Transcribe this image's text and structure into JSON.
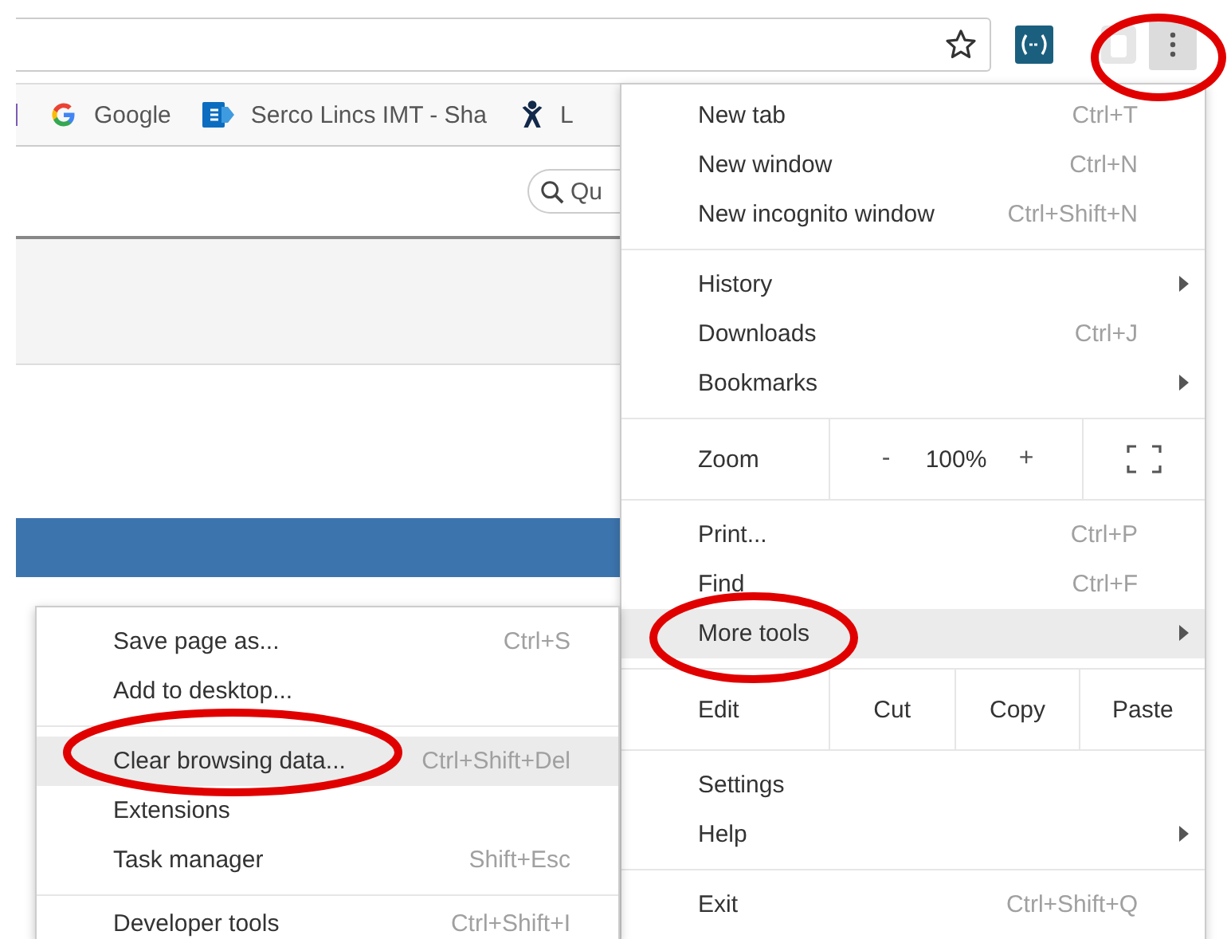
{
  "toolbar": {
    "bookmarked": false
  },
  "bookmarks": [
    {
      "kind": "partial"
    },
    {
      "kind": "google",
      "label": "Google"
    },
    {
      "kind": "sharepoint",
      "label": "Serco Lincs IMT - Sha"
    },
    {
      "kind": "figure",
      "label": "L"
    }
  ],
  "page": {
    "search": {
      "placeholder": "Qu"
    }
  },
  "menu": {
    "sections": [
      {
        "kind": "items",
        "items": [
          {
            "label": "New tab",
            "shortcut": "Ctrl+T",
            "has_submenu": false,
            "selected": false
          },
          {
            "label": "New window",
            "shortcut": "Ctrl+N",
            "has_submenu": false,
            "selected": false
          },
          {
            "label": "New incognito window",
            "shortcut": "Ctrl+Shift+N",
            "has_submenu": false,
            "selected": false
          }
        ]
      },
      {
        "kind": "items",
        "items": [
          {
            "label": "History",
            "has_submenu": true,
            "selected": false
          },
          {
            "label": "Downloads",
            "shortcut": "Ctrl+J",
            "has_submenu": false,
            "selected": false
          },
          {
            "label": "Bookmarks",
            "has_submenu": true,
            "selected": false
          }
        ]
      },
      {
        "kind": "zoom",
        "label": "Zoom",
        "decrease": "-",
        "value": "100%",
        "increase": "+"
      },
      {
        "kind": "items",
        "items": [
          {
            "label": "Print...",
            "shortcut": "Ctrl+P",
            "has_submenu": false,
            "selected": false
          },
          {
            "label": "Find",
            "shortcut": "Ctrl+F",
            "has_submenu": false,
            "selected": false
          },
          {
            "label": "More tools",
            "has_submenu": true,
            "selected": true
          }
        ]
      },
      {
        "kind": "edit",
        "label": "Edit",
        "actions": [
          "Cut",
          "Copy",
          "Paste"
        ]
      },
      {
        "kind": "items",
        "items": [
          {
            "label": "Settings",
            "has_submenu": false,
            "selected": false
          },
          {
            "label": "Help",
            "has_submenu": true,
            "selected": false
          }
        ]
      },
      {
        "kind": "items",
        "items": [
          {
            "label": "Exit",
            "shortcut": "Ctrl+Shift+Q",
            "has_submenu": false,
            "selected": false
          }
        ]
      }
    ]
  },
  "submenu": {
    "sections": [
      {
        "items": [
          {
            "label": "Save page as...",
            "shortcut": "Ctrl+S",
            "selected": false
          },
          {
            "label": "Add to desktop...",
            "selected": false
          }
        ]
      },
      {
        "items": [
          {
            "label": "Clear browsing data...",
            "shortcut": "Ctrl+Shift+Del",
            "selected": true
          },
          {
            "label": "Extensions",
            "selected": false
          },
          {
            "label": "Task manager",
            "shortcut": "Shift+Esc",
            "selected": false
          }
        ]
      },
      {
        "items": [
          {
            "label": "Developer tools",
            "shortcut": "Ctrl+Shift+I",
            "selected": false
          }
        ]
      }
    ]
  }
}
